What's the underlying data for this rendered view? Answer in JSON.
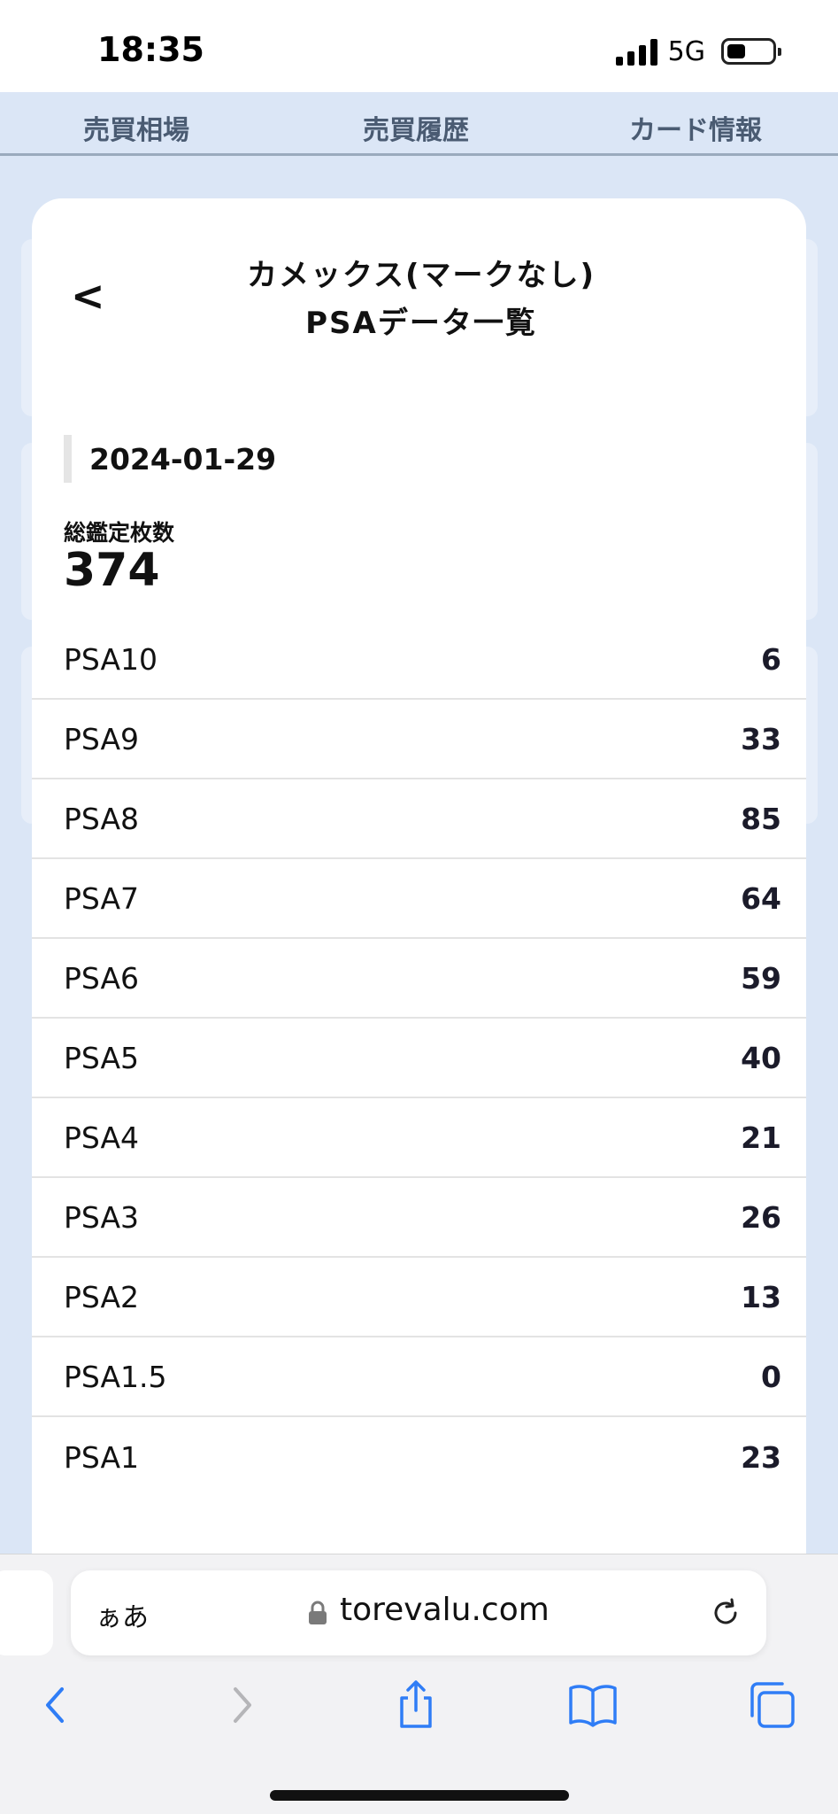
{
  "status_bar": {
    "time": "18:35",
    "network": "5G"
  },
  "tabs": [
    {
      "label": "売買相場"
    },
    {
      "label": "売買履歴"
    },
    {
      "label": "カード情報"
    }
  ],
  "modal": {
    "back_label": "<",
    "title_line1": "カメックス(マークなし)",
    "title_line2": "PSAデータ一覧",
    "date": "2024-01-29",
    "total_label": "総鑑定枚数",
    "total_value": "374",
    "grades": [
      {
        "name": "PSA10",
        "count": "6"
      },
      {
        "name": "PSA9",
        "count": "33"
      },
      {
        "name": "PSA8",
        "count": "85"
      },
      {
        "name": "PSA7",
        "count": "64"
      },
      {
        "name": "PSA6",
        "count": "59"
      },
      {
        "name": "PSA5",
        "count": "40"
      },
      {
        "name": "PSA4",
        "count": "21"
      },
      {
        "name": "PSA3",
        "count": "26"
      },
      {
        "name": "PSA2",
        "count": "13"
      },
      {
        "name": "PSA1.5",
        "count": "0"
      },
      {
        "name": "PSA1",
        "count": "23"
      }
    ]
  },
  "browser": {
    "aa_label": "ぁあ",
    "url": "torevalu.com"
  },
  "colors": {
    "page_bg": "#dbe6f6",
    "tab_text": "#4a5b72",
    "ios_blue": "#2f7df6"
  }
}
